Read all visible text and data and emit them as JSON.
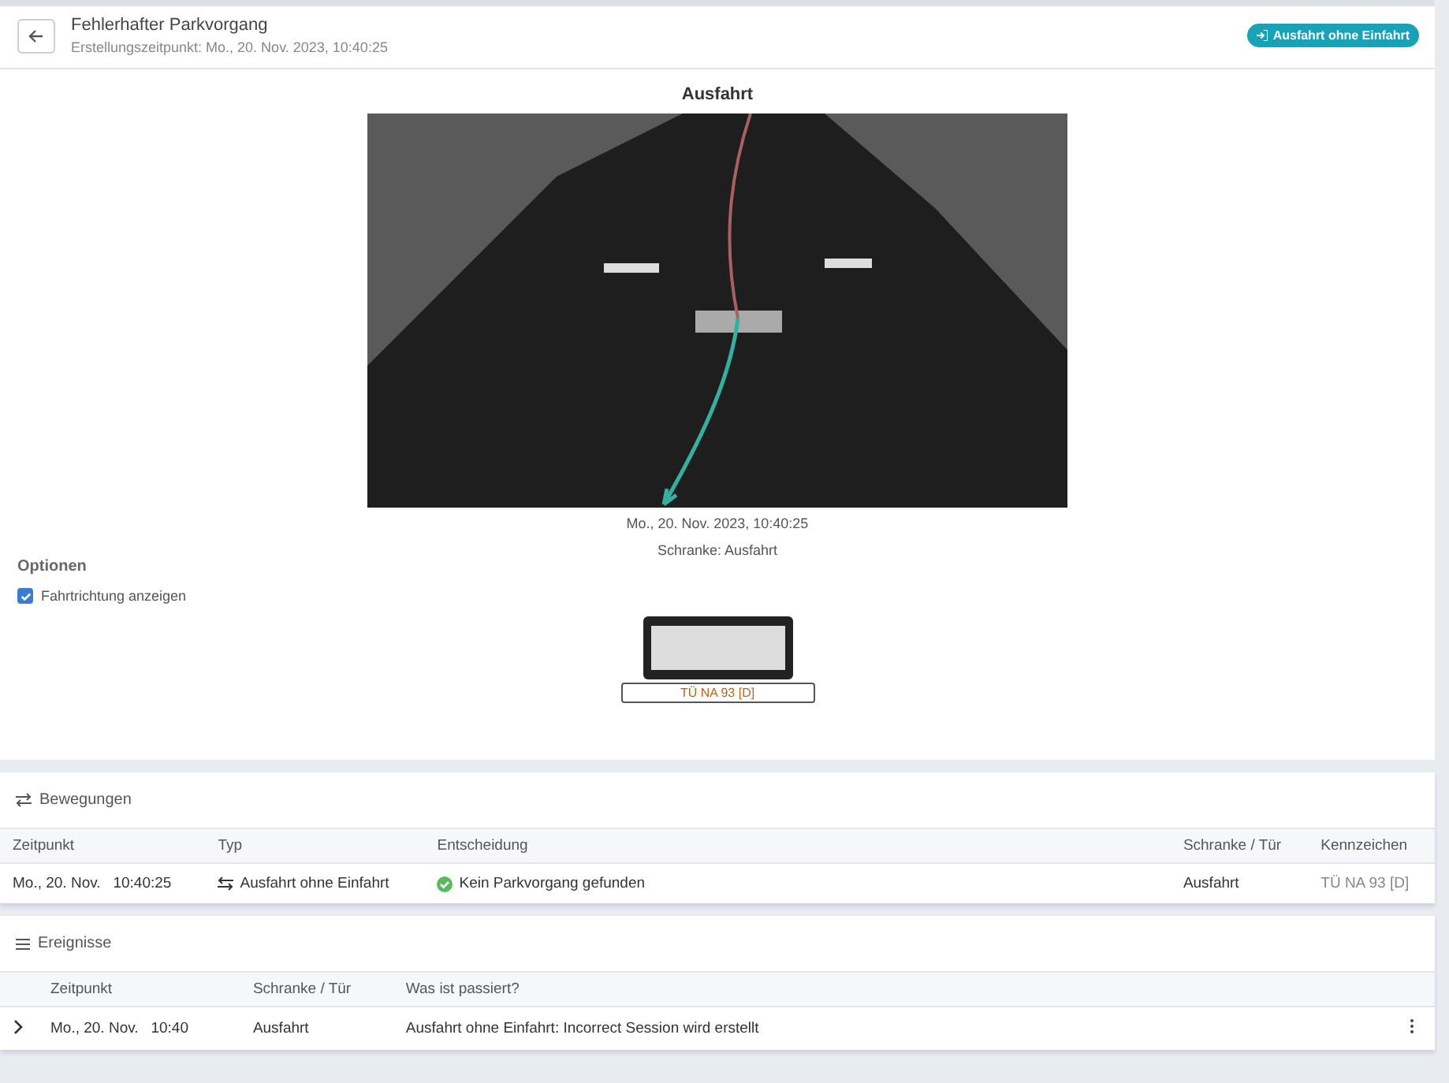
{
  "header": {
    "title": "Fehlerhafter Parkvorgang",
    "subtitle": "Erstellungszeitpunkt: Mo., 20. Nov. 2023, 10:40:25",
    "badge": "Ausfahrt ohne Einfahrt"
  },
  "camera": {
    "title": "Ausfahrt",
    "timestamp": "Mo., 20. Nov. 2023, 10:40:25",
    "gate": "Schranke: Ausfahrt"
  },
  "options": {
    "title": "Optionen",
    "items": [
      {
        "label": "Fahrtrichtung anzeigen",
        "checked": true
      }
    ]
  },
  "plate": {
    "label": "TÜ NA 93 [D]"
  },
  "movements": {
    "title": "Bewegungen",
    "columns": [
      "Zeitpunkt",
      "Typ",
      "Entscheidung",
      "Schranke / Tür",
      "Kennzeichen"
    ],
    "rows": [
      {
        "date": "Mo., 20. Nov.",
        "time": "10:40:25",
        "type": "Ausfahrt ohne Einfahrt",
        "decision": "Kein Parkvorgang gefunden",
        "gate": "Ausfahrt",
        "plate": "TÜ NA 93 [D]"
      }
    ]
  },
  "events": {
    "title": "Ereignisse",
    "columns": [
      "Zeitpunkt",
      "Schranke / Tür",
      "Was ist passiert?"
    ],
    "rows": [
      {
        "expanded": false,
        "date": "Mo., 20. Nov.",
        "time": "10:40",
        "gate": "Ausfahrt",
        "text": "Ausfahrt ohne Einfahrt: Incorrect Session wird erstellt"
      }
    ]
  }
}
